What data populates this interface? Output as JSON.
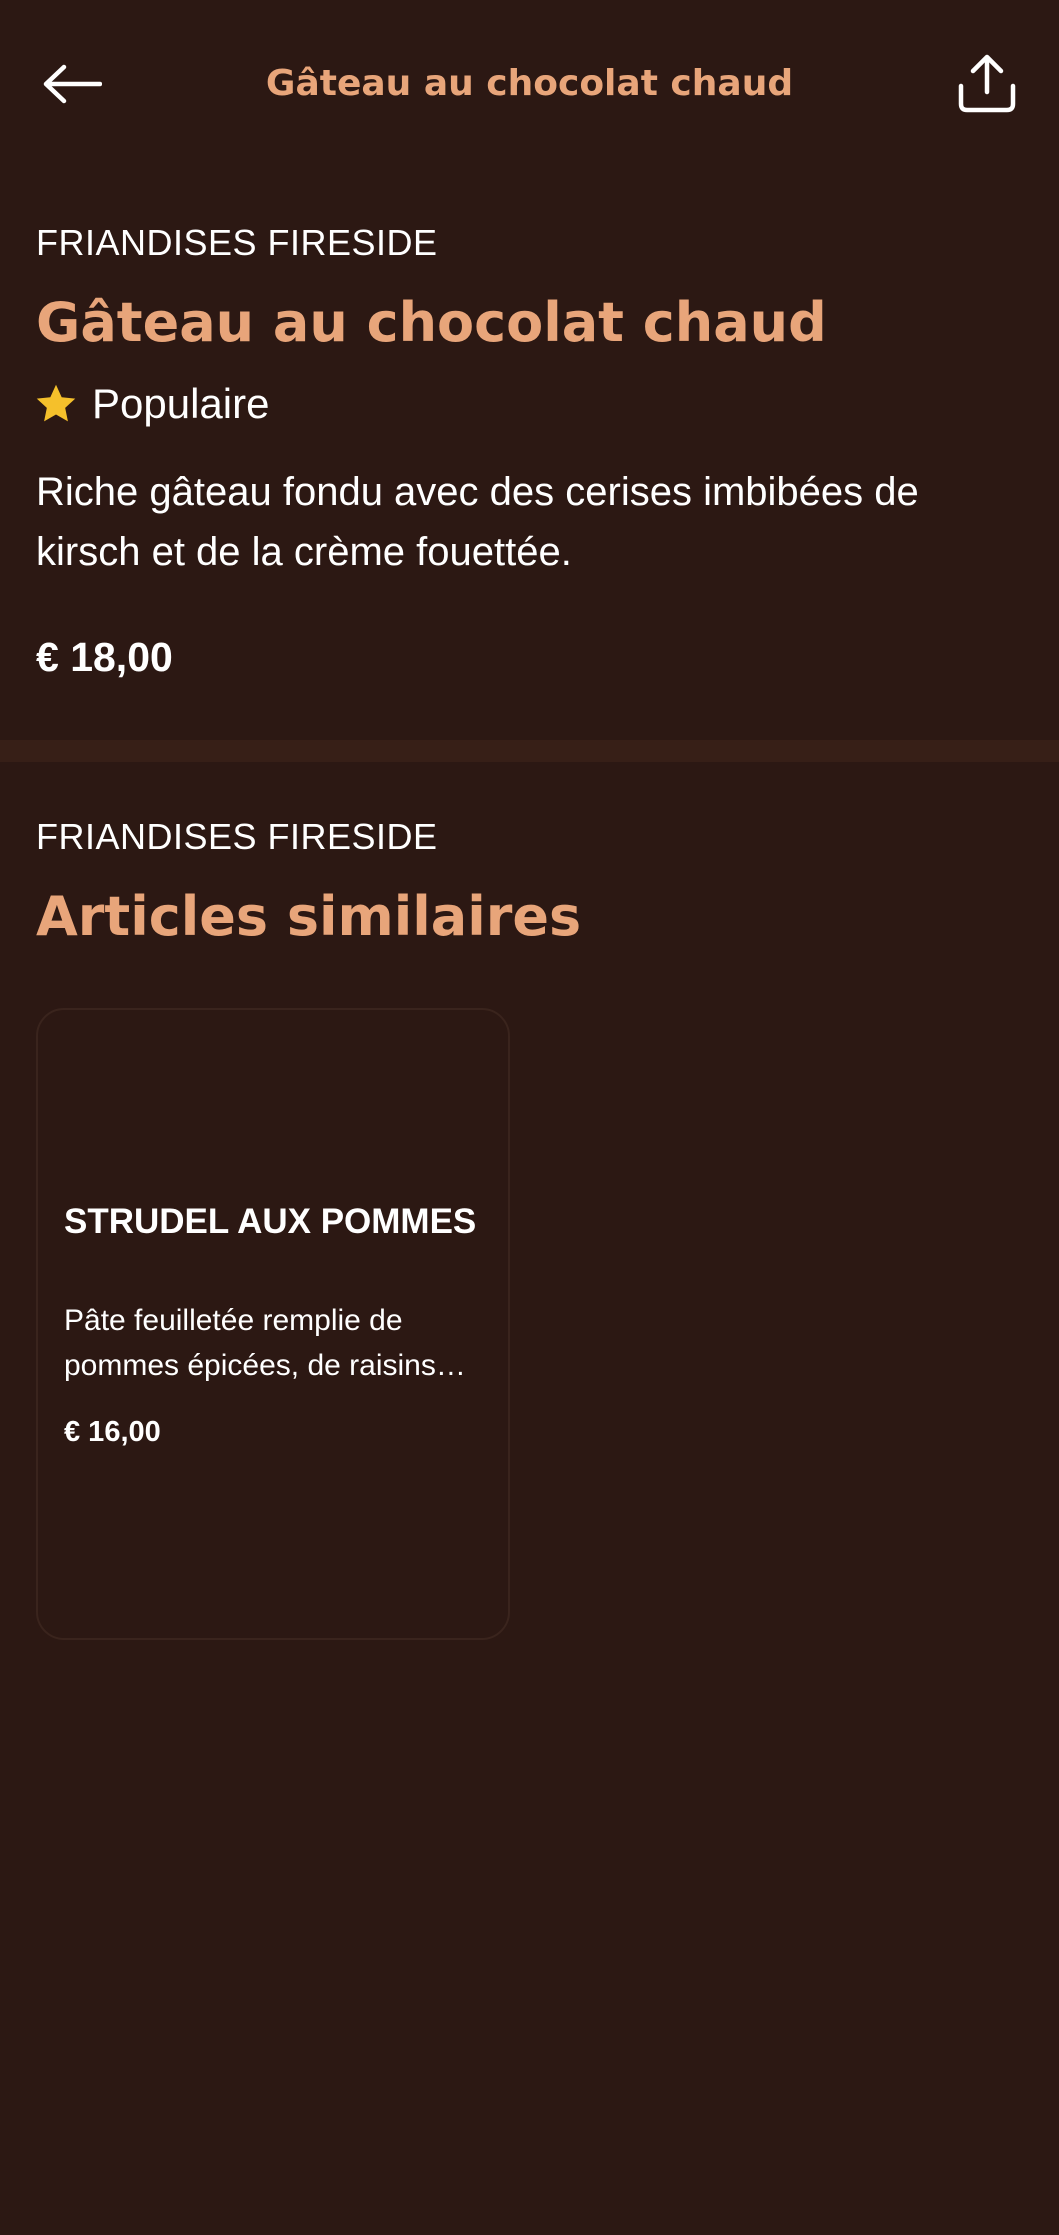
{
  "header": {
    "title": "Gâteau au chocolat chaud",
    "back_icon": "arrow-left-icon",
    "share_icon": "share-icon"
  },
  "product": {
    "category": "FRIANDISES FIRESIDE",
    "name": "Gâteau au chocolat chaud",
    "badge_icon": "star-icon",
    "badge": "Populaire",
    "description": "Riche gâteau fondu avec des cerises imbibées de kirsch et de la crème fouettée.",
    "price": "€ 18,00"
  },
  "similar": {
    "category": "FRIANDISES FIRESIDE",
    "title": "Articles similaires",
    "items": [
      {
        "name": "STRUDEL AUX POMMES",
        "description": "Pâte feuilletée remplie de pommes épicées, de raisins…",
        "price": "€ 16,00"
      }
    ]
  },
  "colors": {
    "background": "#2c1813",
    "accent": "#e8a57a",
    "divider": "#371f17",
    "star": "#f5c02b",
    "text": "#ffffff"
  }
}
